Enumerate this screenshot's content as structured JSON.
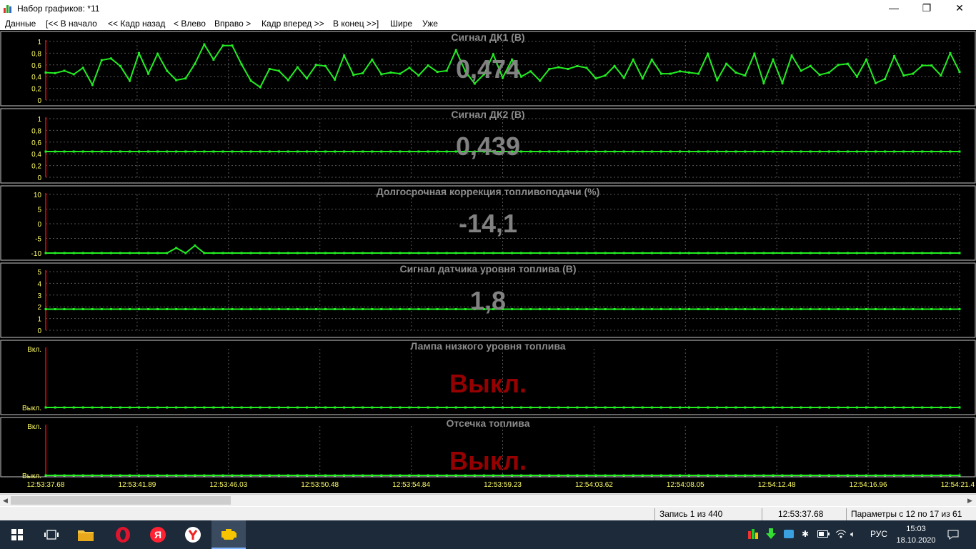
{
  "window": {
    "title": "Набор графиков: *11",
    "minimize": "—",
    "maximize": "❐",
    "close": "✕"
  },
  "menu": [
    "Данные",
    "[<< В начало",
    "<< Кадр назад",
    "< Влево",
    "Вправо >",
    "Кадр вперед >>",
    "В конец >>]",
    "Шире",
    "Уже"
  ],
  "chart_data": [
    {
      "type": "line",
      "title": "Сигнал ДК1  (В)",
      "current_value": "0,474",
      "yticks": [
        "1",
        "0,8",
        "0,6",
        "0,4",
        "0,2",
        "0"
      ],
      "ylim": [
        0,
        1
      ],
      "values": [
        0.47,
        0.46,
        0.5,
        0.44,
        0.55,
        0.26,
        0.68,
        0.71,
        0.58,
        0.33,
        0.8,
        0.45,
        0.79,
        0.5,
        0.34,
        0.37,
        0.62,
        0.95,
        0.69,
        0.93,
        0.93,
        0.61,
        0.33,
        0.22,
        0.53,
        0.5,
        0.34,
        0.56,
        0.37,
        0.6,
        0.58,
        0.35,
        0.76,
        0.43,
        0.46,
        0.69,
        0.44,
        0.47,
        0.45,
        0.55,
        0.42,
        0.59,
        0.48,
        0.5,
        0.85,
        0.49,
        0.28,
        0.44,
        0.78,
        0.38,
        0.69,
        0.4,
        0.49,
        0.33,
        0.53,
        0.56,
        0.53,
        0.58,
        0.55,
        0.37,
        0.42,
        0.58,
        0.38,
        0.69,
        0.37,
        0.69,
        0.45,
        0.45,
        0.49,
        0.47,
        0.45,
        0.79,
        0.34,
        0.62,
        0.47,
        0.42,
        0.79,
        0.29,
        0.69,
        0.29,
        0.76,
        0.5,
        0.58,
        0.43,
        0.47,
        0.6,
        0.62,
        0.4,
        0.69,
        0.29,
        0.36,
        0.75,
        0.42,
        0.45,
        0.59,
        0.59,
        0.42,
        0.8,
        0.48
      ],
      "value_color": "#888888"
    },
    {
      "type": "line",
      "title": "Сигнал ДК2  (В)",
      "current_value": "0,439",
      "yticks": [
        "1",
        "0,8",
        "0,6",
        "0,4",
        "0,2",
        "0"
      ],
      "ylim": [
        0,
        1
      ],
      "constant": 0.439,
      "value_color": "#888888"
    },
    {
      "type": "line",
      "title": "Долгосрочная коррекция топливоподачи  (%)",
      "current_value": "-14,1",
      "yticks": [
        "10",
        "5",
        "0",
        "-5",
        "-10"
      ],
      "ylim": [
        -14.1,
        10
      ],
      "constant": -14.1,
      "bumps": [
        {
          "i": 14,
          "v": -12
        },
        {
          "i": 15,
          "v": -14.1
        },
        {
          "i": 16,
          "v": -11
        }
      ],
      "value_color": "#888888"
    },
    {
      "type": "line",
      "title": "Сигнал датчика уровня топлива  (В)",
      "current_value": "1,8",
      "yticks": [
        "5",
        "4",
        "3",
        "2",
        "1",
        "0"
      ],
      "ylim": [
        0,
        5
      ],
      "constant": 1.8,
      "value_color": "#888888"
    },
    {
      "type": "line",
      "title": "Лампа низкого уровня топлива",
      "current_value": "Выкл.",
      "yticks": [
        "Вкл.",
        "Выкл."
      ],
      "ylim": [
        0,
        1
      ],
      "constant": 0,
      "value_color": "#a00000"
    },
    {
      "type": "line",
      "title": "Отсечка топлива",
      "current_value": "Выкл.",
      "yticks": [
        "Вкл.",
        "Выкл."
      ],
      "ylim": [
        0,
        1
      ],
      "constant": 0,
      "value_color": "#a00000"
    }
  ],
  "x_ticks": [
    "12:53:37.68",
    "12:53:41.89",
    "12:53:46.03",
    "12:53:50.48",
    "12:53:54.84",
    "12:53:59.23",
    "12:54:03.62",
    "12:54:08.05",
    "12:54:12.48",
    "12:54:16.96",
    "12:54:21.4"
  ],
  "status": {
    "record": "Запись 1 из 440",
    "time": "12:53:37.68",
    "params": "Параметры с 12 по 17 из 61"
  },
  "tray": {
    "lang": "РУС",
    "time": "15:03",
    "date": "18.10.2020"
  },
  "colors": {
    "series": "#22ee22",
    "axis": "#ff0000",
    "tick_text": "#ffff66",
    "title_text": "#8c8c8c",
    "grid": "#555555"
  }
}
